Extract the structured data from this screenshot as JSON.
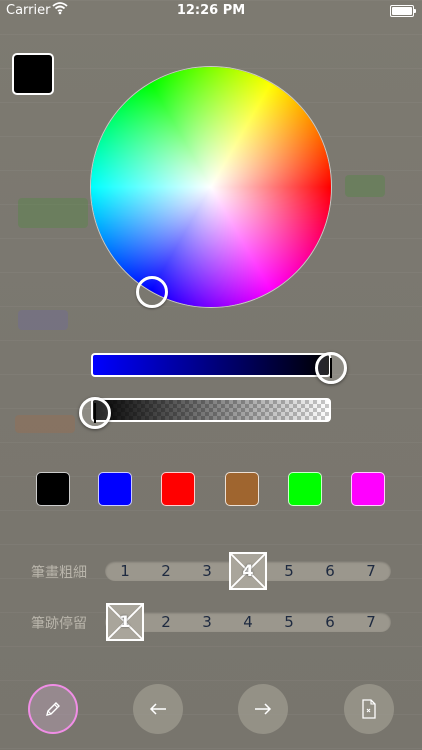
{
  "status_bar": {
    "carrier": "Carrier",
    "time": "12:26 PM",
    "wifi_icon": "wifi-icon",
    "battery_icon": "battery-icon"
  },
  "current_color": "#000000",
  "wheel": {
    "icon": "color-wheel",
    "selected_hue_color": "#0000ff"
  },
  "sliders": {
    "brightness": {
      "start_color": "#0000ff",
      "end_color": "#000000",
      "value": 1.0
    },
    "opacity": {
      "value": 0.0
    }
  },
  "swatches": [
    {
      "name": "black",
      "color": "#000000"
    },
    {
      "name": "blue",
      "color": "#0000ff"
    },
    {
      "name": "red",
      "color": "#ff0000"
    },
    {
      "name": "brown",
      "color": "#9f652f"
    },
    {
      "name": "green",
      "color": "#00ff00"
    },
    {
      "name": "magenta",
      "color": "#ff00ff"
    }
  ],
  "stroke_width": {
    "label": "筆畫粗細",
    "options": [
      "1",
      "2",
      "3",
      "4",
      "5",
      "6",
      "7"
    ],
    "selected": "4"
  },
  "stroke_persist": {
    "label": "筆跡停留",
    "options": [
      "1",
      "2",
      "3",
      "4",
      "5",
      "6",
      "7"
    ],
    "selected": "1"
  },
  "toolbar": {
    "pen_icon": "pencil-icon",
    "undo_icon": "arrow-left-icon",
    "redo_icon": "arrow-right-icon",
    "clear_icon": "document-icon",
    "pen_border_color": "#f08ee6"
  }
}
